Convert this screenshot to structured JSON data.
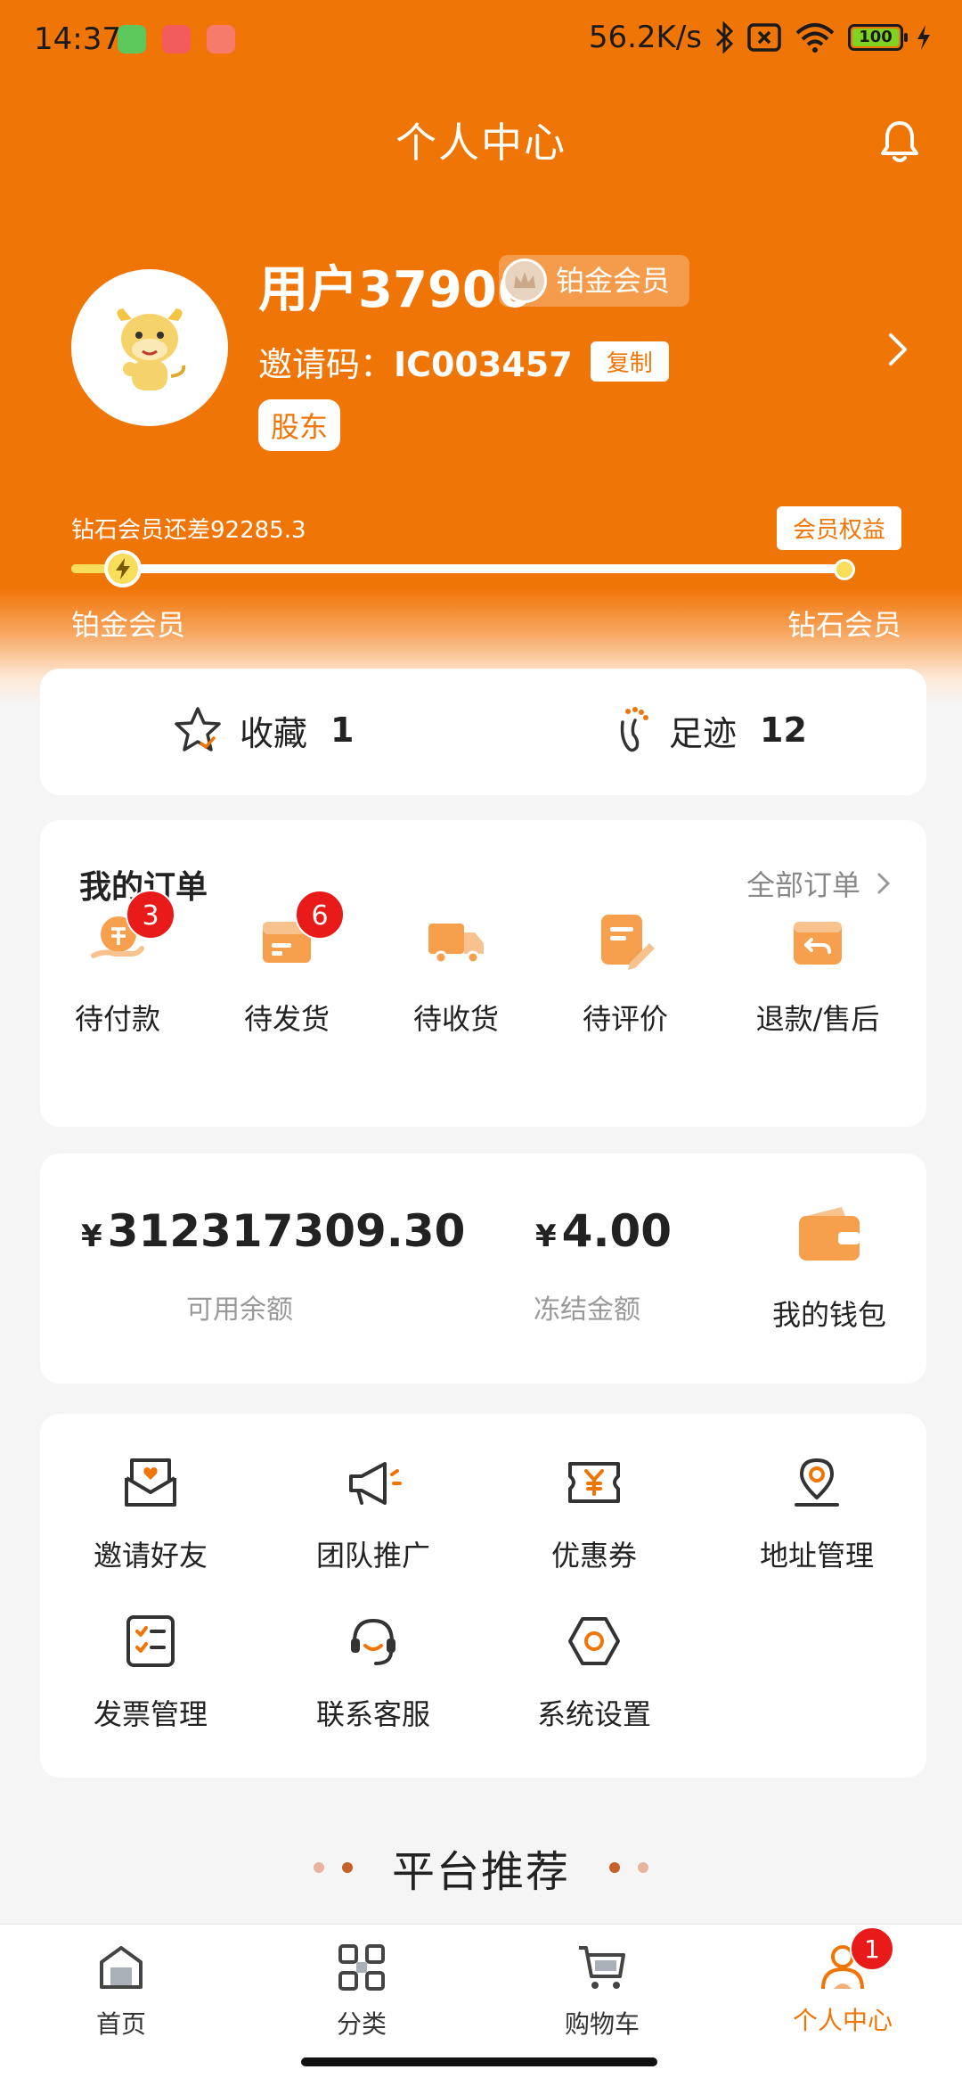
{
  "status_bar": {
    "time": "14:37",
    "net_speed": "56.2K/s",
    "battery": "100"
  },
  "header": {
    "title": "个人中心"
  },
  "profile": {
    "username": "用户37906",
    "member_level": "铂金会员",
    "invite_label": "邀请码：",
    "invite_code": "IC003457",
    "copy_label": "复制",
    "tag": "股东"
  },
  "level": {
    "remaining_text": "钻石会员还差92285.3",
    "benefit_label": "会员权益",
    "current": "铂金会员",
    "next": "钻石会员",
    "progress_fraction": 0.05
  },
  "shortcuts": {
    "favorites_label": "收藏",
    "favorites_count": "1",
    "footprint_label": "足迹",
    "footprint_count": "12"
  },
  "orders": {
    "title": "我的订单",
    "all_label": "全部订单",
    "items": [
      {
        "label": "待付款",
        "badge": "3"
      },
      {
        "label": "待发货",
        "badge": "6"
      },
      {
        "label": "待收货"
      },
      {
        "label": "待评价"
      },
      {
        "label": "退款/售后"
      }
    ]
  },
  "wallet": {
    "currency": "¥",
    "available_amount": "312317309.30",
    "available_label": "可用余额",
    "frozen_amount": "4.00",
    "frozen_label": "冻结金额",
    "wallet_label": "我的钱包"
  },
  "tools": [
    {
      "label": "邀请好友",
      "icon": "invite-envelope-icon"
    },
    {
      "label": "团队推广",
      "icon": "megaphone-icon"
    },
    {
      "label": "优惠券",
      "icon": "coupon-icon"
    },
    {
      "label": "地址管理",
      "icon": "location-pin-icon"
    },
    {
      "label": "发票管理",
      "icon": "invoice-checklist-icon"
    },
    {
      "label": "联系客服",
      "icon": "headset-icon"
    },
    {
      "label": "系统设置",
      "icon": "hexagon-settings-icon"
    }
  ],
  "recommend": {
    "title": "平台推荐"
  },
  "tabbar": {
    "items": [
      {
        "label": "首页"
      },
      {
        "label": "分类"
      },
      {
        "label": "购物车"
      },
      {
        "label": "个人中心",
        "badge": "1"
      }
    ]
  },
  "colors": {
    "brand": "#f07507",
    "badge": "#e81a1a",
    "progress": "#f8de5a"
  }
}
